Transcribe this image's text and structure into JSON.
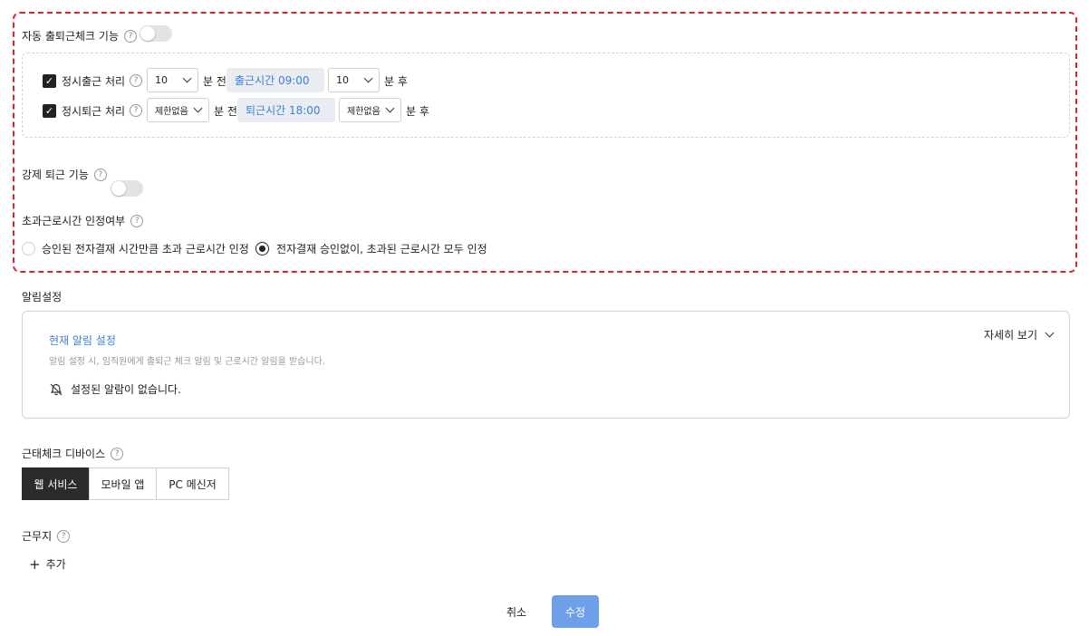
{
  "auto_checkin": {
    "label": "자동 출퇴근체크 기능",
    "rows": [
      {
        "label": "정시출근 처리",
        "select1": "10",
        "before": "분 전",
        "time": "출근시간 09:00",
        "select2": "10",
        "after": "분 후"
      },
      {
        "label": "정시퇴근 처리",
        "select1": "제한없음",
        "before": "분 전",
        "time": "퇴근시간 18:00",
        "select2": "제한없음",
        "after": "분 후"
      }
    ]
  },
  "force_checkout": {
    "label": "강제 퇴근 기능"
  },
  "overtime": {
    "label": "초과근로시간 인정여부",
    "options": [
      "승인된 전자결재 시간만큼 초과 근로시간 인정",
      "전자결재 승인없이, 초과된 근로시간 모두 인정"
    ],
    "selected_index": 1
  },
  "notification": {
    "section_label": "알림설정",
    "current_title": "현재 알림 설정",
    "description": "알림 설정 시, 임직원에게 출퇴근 체크 알림 및 근로시간 알림을 받습니다.",
    "details_label": "자세히 보기",
    "empty_text": "설정된 알람이 없습니다."
  },
  "device": {
    "label": "근태체크 디바이스",
    "tabs": [
      "웹 서비스",
      "모바일 앱",
      "PC 메신저"
    ],
    "active_index": 0
  },
  "workplace": {
    "label": "근무지",
    "add_label": "추가"
  },
  "actions": {
    "cancel": "취소",
    "submit": "수정"
  },
  "colors": {
    "highlight_border": "#d9232e",
    "link_blue": "#3d7fd9",
    "submit_blue": "#6ea0ea",
    "active_tab": "#2b2b2b"
  }
}
